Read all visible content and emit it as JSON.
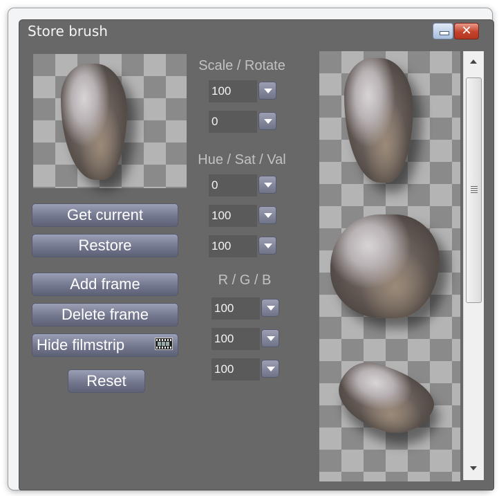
{
  "window": {
    "title": "Store brush"
  },
  "icons": {
    "minimize": "minimize-icon",
    "close": "close-icon",
    "close_glyph": "✕",
    "filmstrip": "filmstrip-icon",
    "dropdown": "chevron-down-icon"
  },
  "colors": {
    "panel_bg": "#686868",
    "button_gradient_top": "#9b9fb5",
    "button_gradient_bottom": "#5d6176",
    "label_text": "#c2c2c2",
    "close_button": "#c4422c"
  },
  "buttons": {
    "get_current": "Get current",
    "restore": "Restore",
    "add_frame": "Add frame",
    "delete_frame": "Delete frame",
    "hide_filmstrip": "Hide filmstrip",
    "reset": "Reset"
  },
  "scale_rotate": {
    "label": "Scale / Rotate",
    "scale": "100",
    "rotate": "0"
  },
  "hsv": {
    "label": "Hue / Sat / Val",
    "hue": "0",
    "sat": "100",
    "val": "100"
  },
  "rgb": {
    "label": "R / G / B",
    "r": "100",
    "g": "100",
    "b": "100"
  },
  "filmstrip": {
    "frames": [
      "brush-frame-1",
      "brush-frame-2",
      "brush-frame-3"
    ]
  }
}
